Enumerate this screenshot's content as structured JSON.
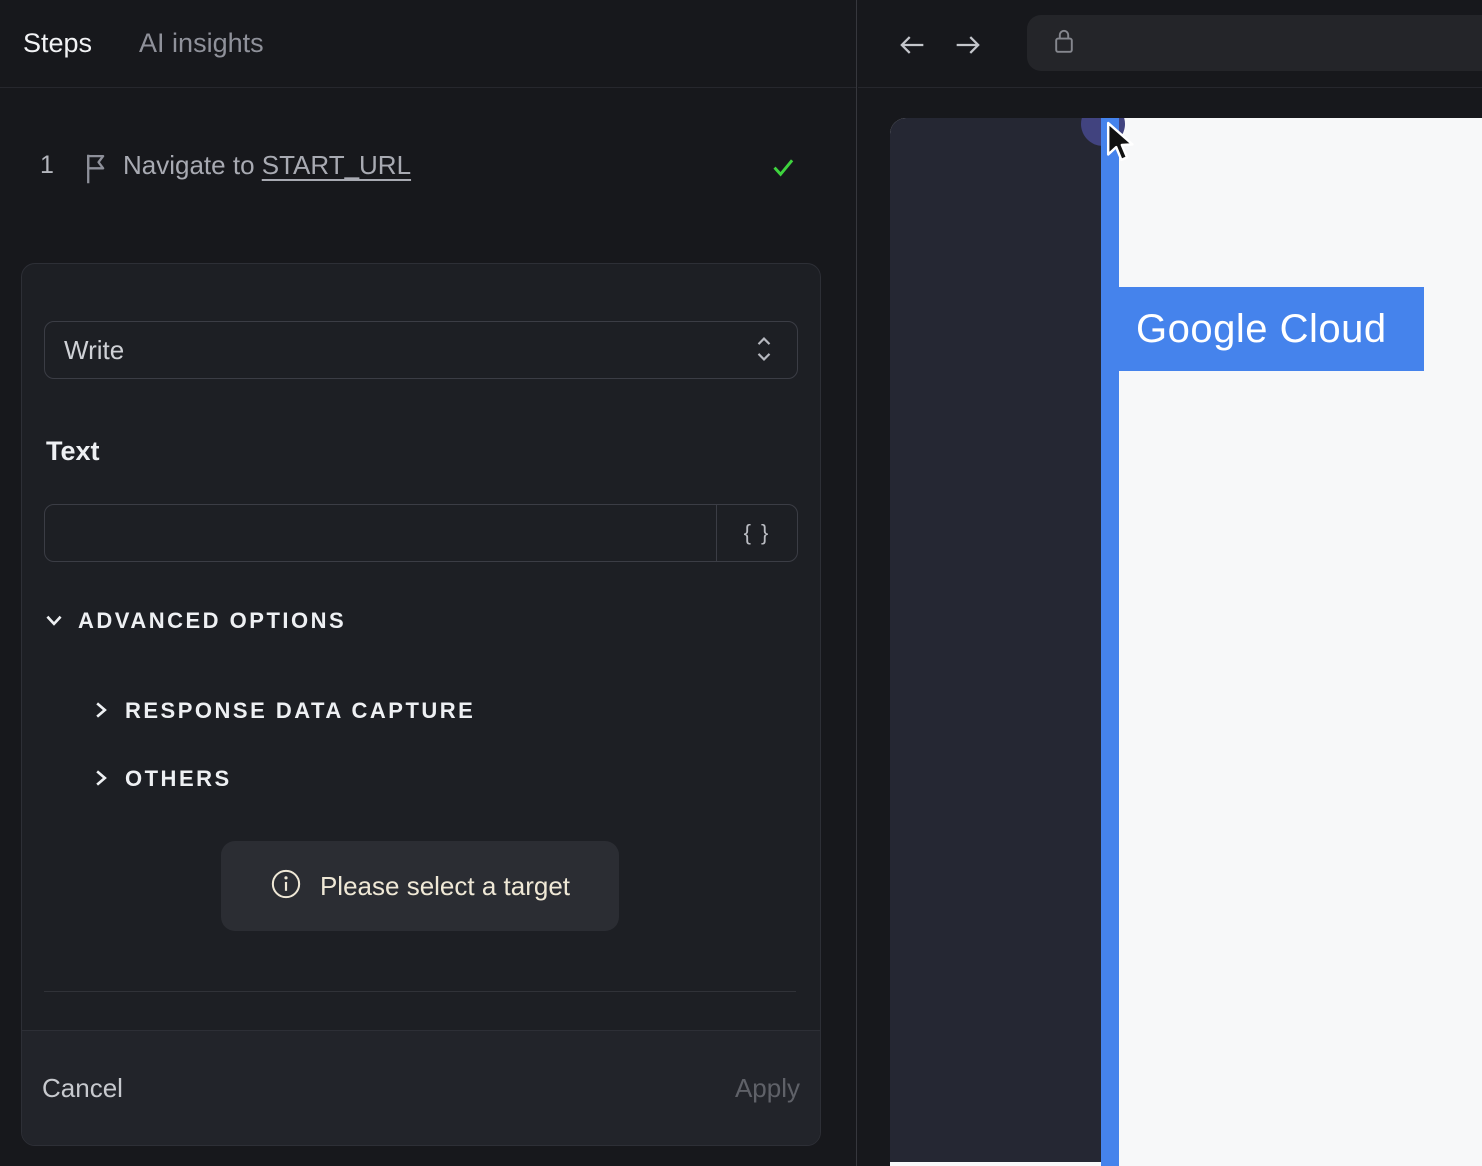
{
  "colors": {
    "app-bg": "#17181c",
    "card-bg": "#1d1f24",
    "card-border": "#2d2f36",
    "field-border": "#3b3d45",
    "footer-bg": "#22242a",
    "toast-bg": "#2b2d33",
    "toast-text": "#efe8d6",
    "text-primary": "#f2f3f5",
    "text-secondary": "#a8aab2",
    "text-muted": "#8f919a",
    "apply-disabled": "#5f6168",
    "success-green": "#3ed33e",
    "accent-blue": "#4583ec",
    "indigo-dot": "#41437f",
    "page-dark": "#252733",
    "page-white": "#f7f8f9",
    "addressbar-bg": "#242529"
  },
  "left_panel": {
    "tabs": [
      {
        "label": "Steps"
      },
      {
        "label": "AI insights"
      }
    ],
    "step": {
      "number": "1",
      "label": "Navigate to ",
      "link": "START_URL"
    },
    "editor": {
      "action_select": {
        "value": "Write"
      },
      "text_field": {
        "label": "Text",
        "value": "",
        "placeholder": ""
      },
      "variables_button_label": "{ }",
      "advanced_options_label": "ADVANCED OPTIONS",
      "response_data_capture_label": "RESPONSE DATA CAPTURE",
      "others_label": "OTHERS",
      "toast_text": "Please select a target",
      "cancel_label": "Cancel",
      "apply_label": "Apply"
    }
  },
  "browser": {
    "address_bar": {
      "value": ""
    },
    "page_highlight_label": "Google Cloud"
  }
}
